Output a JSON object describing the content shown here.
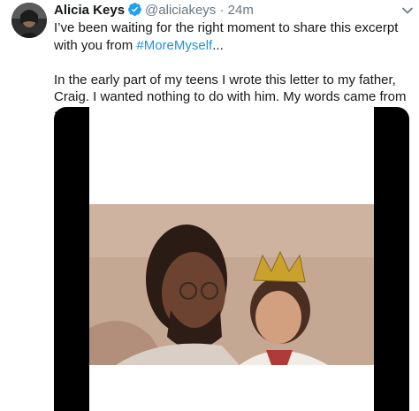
{
  "tweet": {
    "author_name": "Alicia Keys",
    "handle": "@aliciakeys",
    "separator": "·",
    "time": "24m",
    "text_line1_before": "I’ve been waiting for the right moment to share this excerpt with you from ",
    "hashtag": "#MoreMyself",
    "text_line1_after": "...",
    "paragraph2": "In the early part of my teens I wrote this letter to my father, Craig. I wanted nothing to do with him. My words came from a place of vulnerability and longing."
  },
  "icons": {
    "verified": "verified-badge-icon",
    "more": "chevron-down-icon"
  },
  "colors": {
    "hashtag": "#1b95e0",
    "verified": "#1da1f2",
    "secondary_text": "#657786",
    "media_frame": "#000000"
  }
}
